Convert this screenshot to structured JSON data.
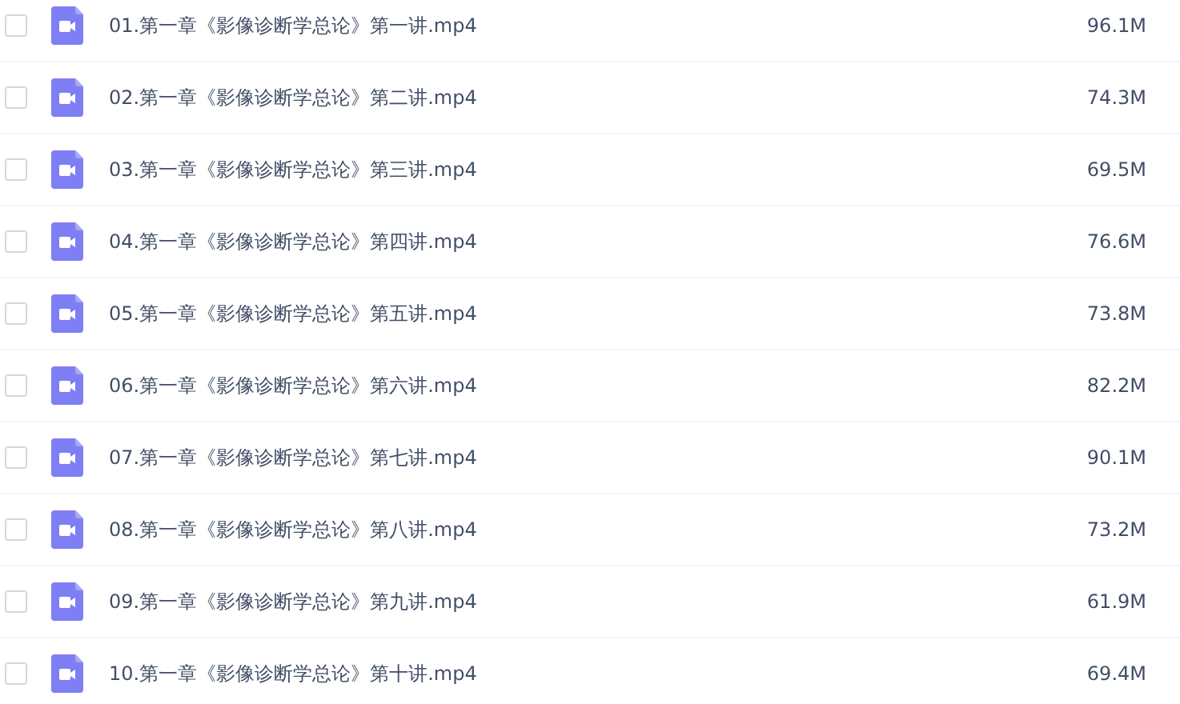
{
  "files": [
    {
      "name": "01.第一章《影像诊断学总论》第一讲.mp4",
      "size": "96.1M",
      "checked": false
    },
    {
      "name": "02.第一章《影像诊断学总论》第二讲.mp4",
      "size": "74.3M",
      "checked": false
    },
    {
      "name": "03.第一章《影像诊断学总论》第三讲.mp4",
      "size": "69.5M",
      "checked": false
    },
    {
      "name": "04.第一章《影像诊断学总论》第四讲.mp4",
      "size": "76.6M",
      "checked": false
    },
    {
      "name": "05.第一章《影像诊断学总论》第五讲.mp4",
      "size": "73.8M",
      "checked": false
    },
    {
      "name": "06.第一章《影像诊断学总论》第六讲.mp4",
      "size": "82.2M",
      "checked": false
    },
    {
      "name": "07.第一章《影像诊断学总论》第七讲.mp4",
      "size": "90.1M",
      "checked": false
    },
    {
      "name": "08.第一章《影像诊断学总论》第八讲.mp4",
      "size": "73.2M",
      "checked": false
    },
    {
      "name": "09.第一章《影像诊断学总论》第九讲.mp4",
      "size": "61.9M",
      "checked": false
    },
    {
      "name": "10.第一章《影像诊断学总论》第十讲.mp4",
      "size": "69.4M",
      "checked": false
    }
  ]
}
